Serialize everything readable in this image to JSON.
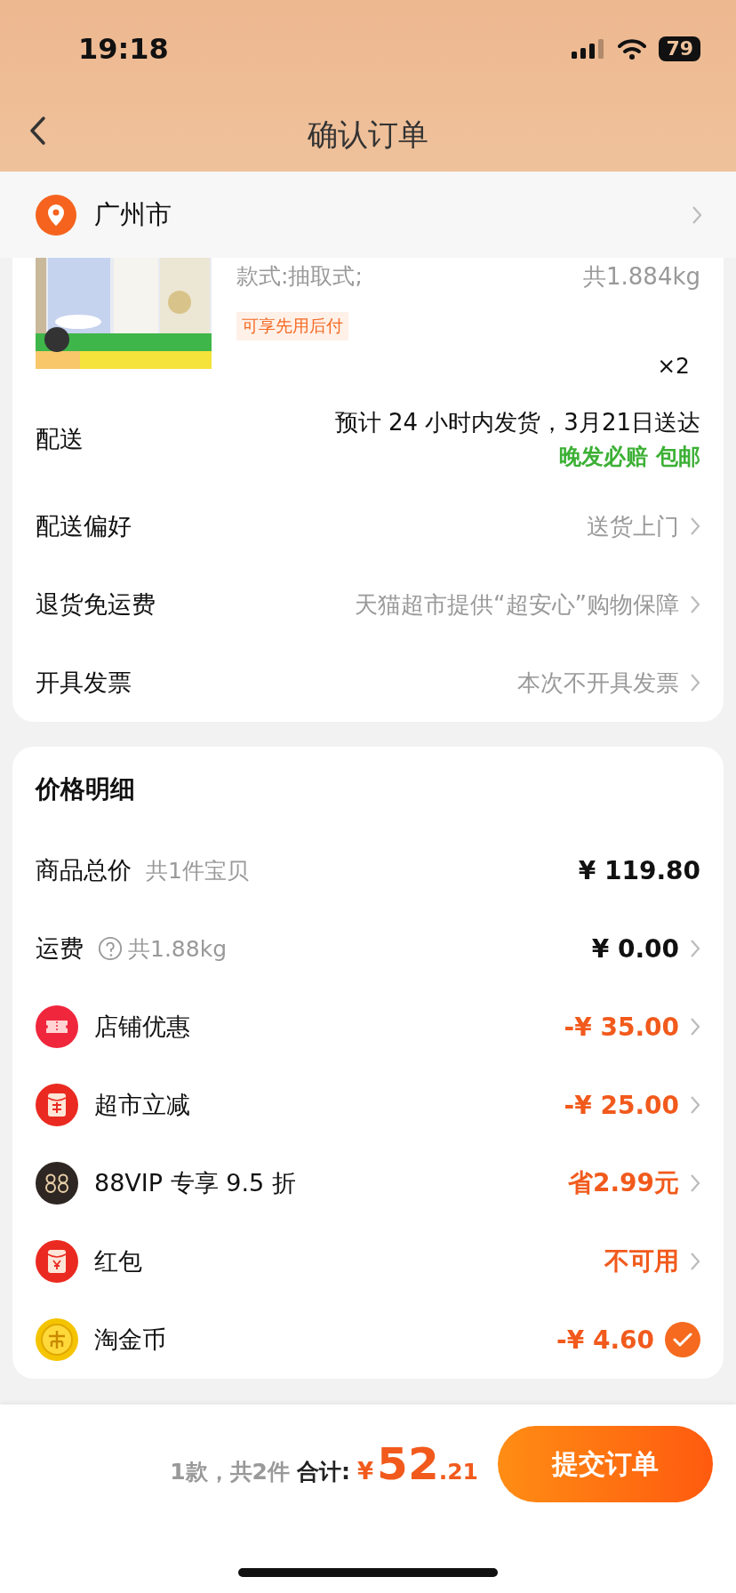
{
  "status_bar": {
    "time": "19:18",
    "battery": "79"
  },
  "nav": {
    "title": "确认订单"
  },
  "address": {
    "city": "广州市"
  },
  "product": {
    "spec": "款式:抽取式;",
    "weight": "共1.884kg",
    "badge": "可享先用后付",
    "quantity": "×2"
  },
  "order_rows": [
    {
      "label": "配送",
      "lines": [
        "预计 24 小时内发货，3月21日送达"
      ],
      "highlight": "晚发必赔 包邮",
      "chevron": false
    },
    {
      "label": "配送偏好",
      "lines": [
        "送货上门"
      ],
      "chevron": true
    },
    {
      "label": "退货免运费",
      "lines": [
        "天猫超市提供“超安心”购物保障"
      ],
      "chevron": true
    },
    {
      "label": "开具发票",
      "lines": [
        "本次不开具发票"
      ],
      "chevron": true
    }
  ],
  "price_detail": {
    "title": "价格明细",
    "rows": [
      {
        "kind": "total",
        "label": "商品总价",
        "note": "共1件宝贝",
        "value": "¥ 119.80"
      },
      {
        "kind": "shipping",
        "label": "运费",
        "note": "共1.88kg",
        "value": "¥ 0.00"
      },
      {
        "kind": "ticket",
        "label": "店铺优惠",
        "value": "-¥ 35.00"
      },
      {
        "kind": "envelope",
        "label": "超市立减",
        "value": "-¥ 25.00"
      },
      {
        "kind": "vip",
        "label": "88VIP 专享 9.5 折",
        "value": "省2.99元"
      },
      {
        "kind": "packet",
        "label": "红包",
        "value": "不可用"
      },
      {
        "kind": "coin",
        "label": "淘金币",
        "value": "-¥ 4.60",
        "checked": true
      }
    ]
  },
  "footer": {
    "summary": "1款，共2件",
    "total_label": "合计:",
    "currency": "¥",
    "total_integer": "52",
    "total_decimal": ".21",
    "submit": "提交订单"
  }
}
